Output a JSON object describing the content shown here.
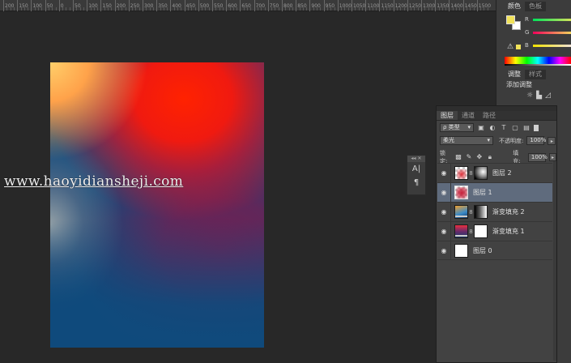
{
  "ruler": {
    "labels": [
      "200",
      "150",
      "100",
      "50",
      "0",
      "50",
      "100",
      "150",
      "200",
      "250",
      "300",
      "350",
      "400",
      "450",
      "500",
      "550",
      "600",
      "650",
      "700",
      "750",
      "800",
      "850",
      "900",
      "950",
      "1000",
      "1050",
      "1100",
      "1150",
      "1200",
      "1250",
      "1300",
      "1350",
      "1400",
      "1450",
      "1500"
    ]
  },
  "watermark": "www.haoyidiansheji.com",
  "colors": {
    "foreground": "#f1e25a",
    "background": "#ffffff",
    "art_red": "#ff2a0a",
    "art_orange": "#ffc060",
    "art_navy": "#0f4a7c",
    "art_purple": "#6e2154",
    "selection": "#5f6b7d"
  },
  "color_panel": {
    "tabs": [
      "颜色",
      "色板"
    ],
    "channels": [
      "R",
      "G",
      "B"
    ],
    "warning_icon": "warning-icon"
  },
  "adjustments_panel": {
    "tabs": [
      "调整",
      "样式"
    ],
    "title": "添加调整"
  },
  "mini_panel": {
    "grip": "◂◂ ✕",
    "icons": [
      "character-icon",
      "paragraph-icon"
    ]
  },
  "layers_panel": {
    "tabs": [
      "图层",
      "通道",
      "路径"
    ],
    "filter_kind": "ρ 类型",
    "blend_mode": "柔光",
    "opacity_label": "不透明度:",
    "opacity_value": "100%",
    "lock_label": "锁定:",
    "fill_label": "填充:",
    "fill_value": "100%",
    "layers": [
      {
        "name": "图层 2",
        "selected": false,
        "has_mask": true
      },
      {
        "name": "图层 1",
        "selected": true,
        "has_mask": false
      },
      {
        "name": "渐变填充 2",
        "selected": false,
        "has_mask": true
      },
      {
        "name": "渐变填充 1",
        "selected": false,
        "has_mask": true
      },
      {
        "name": "图层 0",
        "selected": false,
        "has_mask": false
      }
    ]
  }
}
